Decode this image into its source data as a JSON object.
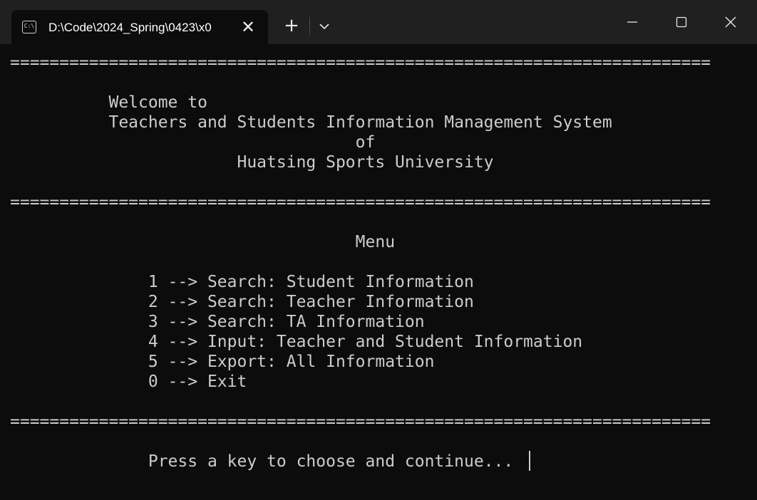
{
  "window": {
    "tab_title": "D:\\Code\\2024_Spring\\0423\\x0",
    "tab_icon_text": "C:\\",
    "close_tab_glyph": "✕",
    "new_tab_glyph": "+"
  },
  "terminal": {
    "lines": [
      "=======================================================================",
      "",
      "          Welcome to",
      "          Teachers and Students Information Management System",
      "                                   of",
      "                       Huatsing Sports University",
      "",
      "=======================================================================",
      "",
      "                                   Menu",
      "",
      "              1 --> Search: Student Information",
      "              2 --> Search: Teacher Information",
      "              3 --> Search: TA Information",
      "              4 --> Input: Teacher and Student Information",
      "              5 --> Export: All Information",
      "              0 --> Exit",
      "",
      "=======================================================================",
      "",
      "              Press a key to choose and continue... "
    ]
  },
  "colors": {
    "terminal_bg": "#0c0c0c",
    "titlebar_bg": "#202020",
    "text": "#cccccc"
  }
}
